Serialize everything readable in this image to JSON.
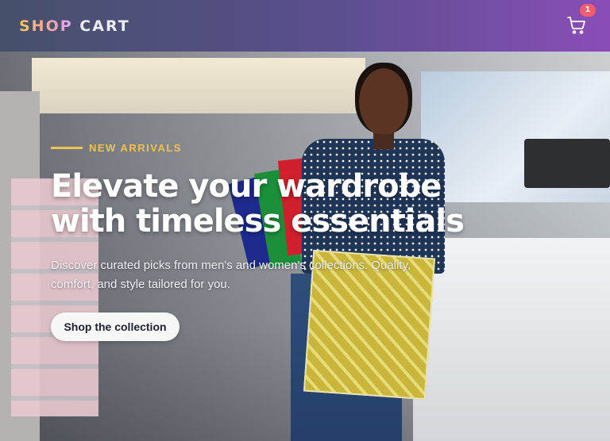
{
  "header": {
    "brand_part1": "SHOP",
    "brand_part2": "CART",
    "cart_icon": "shopping-cart-icon",
    "cart_count": "1"
  },
  "hero": {
    "eyebrow": "NEW ARRIVALS",
    "headline_line1": "Elevate your wardrobe",
    "headline_line2": "with timeless essentials",
    "subtext_line1": "Discover curated picks from men's and women's collections. Quality,",
    "subtext_line2": "comfort, and style tailored for you.",
    "cta_label": "Shop the collection"
  },
  "colors": {
    "accent": "#f1c34e",
    "badge": "#f05d6c",
    "header_start": "#45506a",
    "header_end": "#8a4db8"
  }
}
